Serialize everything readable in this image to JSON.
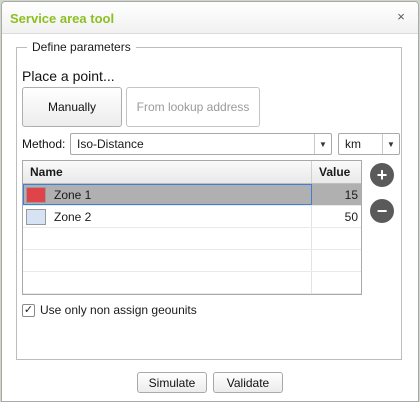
{
  "window": {
    "title": "Service area tool",
    "close_glyph": "×"
  },
  "params": {
    "legend": "Define parameters",
    "place_label": "Place a point...",
    "manually_label": "Manually",
    "lookup_label": "From lookup address",
    "method_label": "Method:",
    "method_value": "Iso-Distance",
    "unit_value": "km"
  },
  "zones": {
    "columns": {
      "name": "Name",
      "value": "Value"
    },
    "rows": [
      {
        "name": "Zone 1",
        "value": "15",
        "color": "#e0434a",
        "selected": true
      },
      {
        "name": "Zone 2",
        "value": "50",
        "color": "#d6e3f5",
        "selected": false
      }
    ]
  },
  "icons": {
    "add": "plus-icon",
    "remove": "minus-icon",
    "dropdown": "chevron-down-icon",
    "close": "close-icon",
    "check": "checkmark-icon"
  },
  "checkbox": {
    "label": "Use only non assign geounits",
    "checked": true
  },
  "footer": {
    "simulate_label": "Simulate",
    "validate_label": "Validate"
  },
  "colors": {
    "title": "#8dbf22",
    "selected_row": "#b0b0b0",
    "selection_outline": "#3e7fd8"
  }
}
